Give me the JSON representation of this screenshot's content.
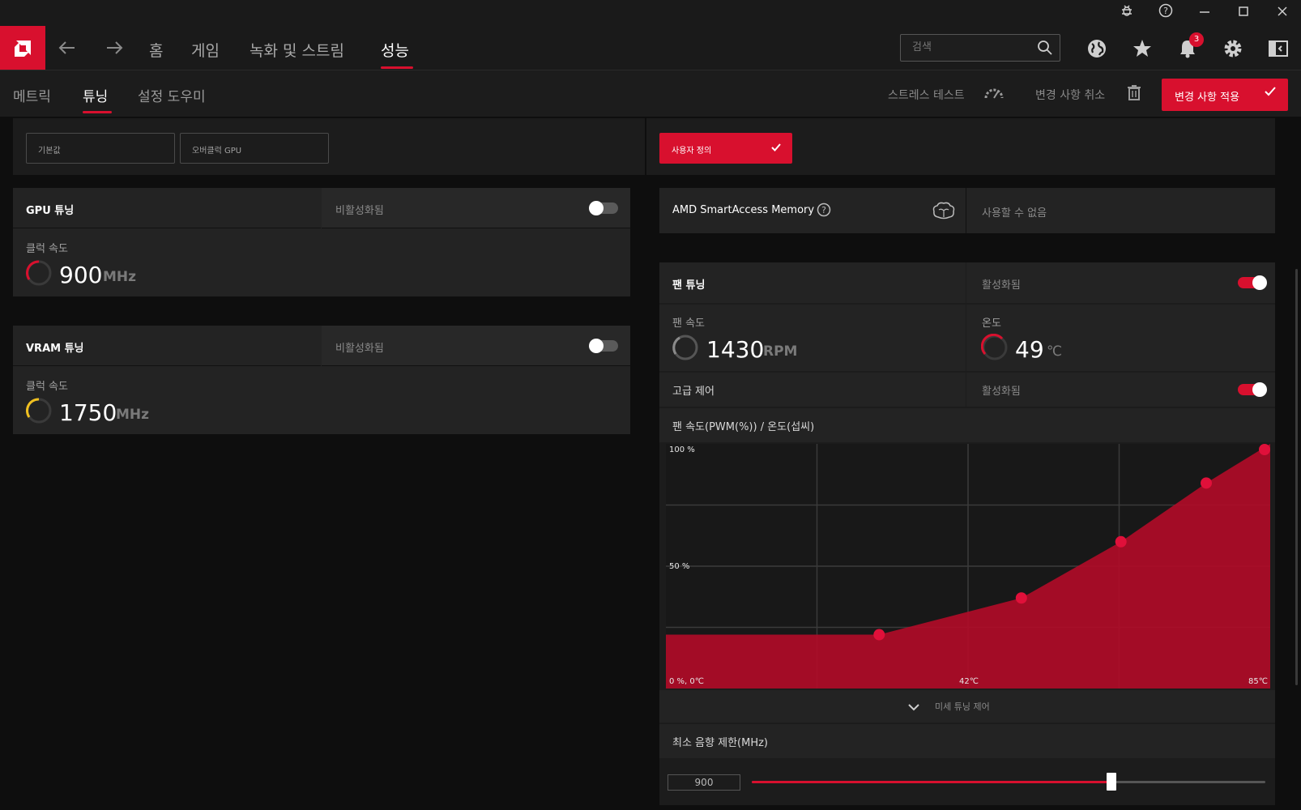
{
  "window": {
    "controls": [
      "bug-icon",
      "help-icon",
      "minimize-icon",
      "maximize-icon",
      "close-icon"
    ]
  },
  "nav": {
    "home": "홈",
    "games": "게임",
    "record_stream": "녹화 및 스트림",
    "performance": "성능",
    "search_placeholder": "검색",
    "notification_count": "3"
  },
  "subnav": {
    "metrics": "메트릭",
    "tuning": "튜닝",
    "setup_wizard": "설정 도우미",
    "stress_test": "스트레스 테스트",
    "discard_changes": "변경 사항 취소",
    "apply_changes": "변경 사항 적용"
  },
  "presets": {
    "default": "기본값",
    "overclock_gpu": "오버클럭 GPU",
    "custom": "사용자 정의"
  },
  "gpu_tuning": {
    "title": "GPU 튜닝",
    "status": "비활성화됨",
    "enabled": false,
    "clock_label": "클럭 속도",
    "clock_value": "900",
    "clock_unit": "MHz"
  },
  "vram_tuning": {
    "title": "VRAM 튜닝",
    "status": "비활성화됨",
    "enabled": false,
    "clock_label": "클럭 속도",
    "clock_value": "1750",
    "clock_unit": "MHz"
  },
  "smart_access": {
    "title": "AMD SmartAccess Memory",
    "status": "사용할 수 없음"
  },
  "fan_tuning": {
    "title": "팬 튜닝",
    "status": "활성화됨",
    "enabled": true,
    "speed_label": "팬 속도",
    "speed_value": "1430",
    "speed_unit": "RPM",
    "temp_label": "온도",
    "temp_value": "49",
    "temp_unit": "℃",
    "advanced_label": "고급 제어",
    "advanced_status": "활성화됨",
    "advanced_enabled": true,
    "chart_title": "팬 속도(PWM(%)) / 온도(섭씨)",
    "fine_tune": "미세 튜닝 제어",
    "min_acoustic_label": "최소 음향 제한(MHz)",
    "min_acoustic_value": "900",
    "min_acoustic_fraction": 0.7
  },
  "chart_data": {
    "type": "area",
    "title": "팬 속도(PWM(%)) / 온도(섭씨)",
    "xlabel": "",
    "ylabel": "",
    "xlim": [
      0,
      85
    ],
    "ylim": [
      0,
      100
    ],
    "y_tick_labels": [
      "100 %",
      "50 %"
    ],
    "x_tick_labels": [
      "0 %, 0℃",
      "42℃",
      "85℃"
    ],
    "points": [
      {
        "x": 0,
        "y": 22
      },
      {
        "x": 30,
        "y": 22
      },
      {
        "x": 50,
        "y": 37
      },
      {
        "x": 64,
        "y": 60
      },
      {
        "x": 76,
        "y": 84
      },
      {
        "x": 85,
        "y": 100
      }
    ],
    "grid": true,
    "fill_color": "#b00c28",
    "point_color": "#e0103a"
  },
  "colors": {
    "accent": "#d8102e",
    "gauge_yellow": "#f0c020"
  }
}
